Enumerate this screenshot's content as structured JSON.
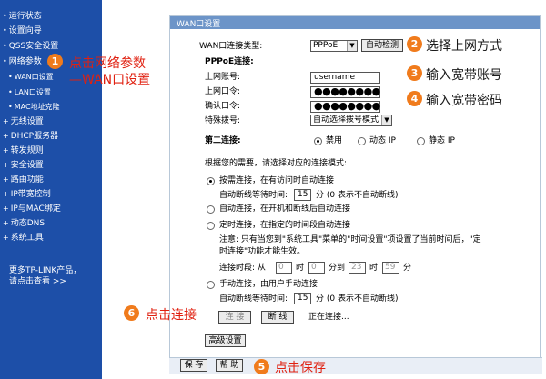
{
  "sidebar": {
    "items": [
      {
        "label": "运行状态"
      },
      {
        "label": "设置向导"
      },
      {
        "label": "QSS安全设置"
      },
      {
        "label": "网络参数"
      },
      {
        "label": "WAN口设置"
      },
      {
        "label": "LAN口设置"
      },
      {
        "label": "MAC地址克隆"
      },
      {
        "label": "无线设置"
      },
      {
        "label": "DHCP服务器"
      },
      {
        "label": "转发规则"
      },
      {
        "label": "安全设置"
      },
      {
        "label": "路由功能"
      },
      {
        "label": "IP带宽控制"
      },
      {
        "label": "IP与MAC绑定"
      },
      {
        "label": "动态DNS"
      },
      {
        "label": "系统工具"
      }
    ],
    "more_line1": "更多TP-LINK产品，",
    "more_line2": "请点击查看 >>"
  },
  "panel": {
    "title": "WAN口设置",
    "wan_type_label": "WAN口连接类型:",
    "wan_type_value": "PPPoE",
    "auto_detect": "自动检测",
    "pppoe_heading": "PPPoE连接:",
    "account_label": "上网账号:",
    "account_value": "username",
    "password_label": "上网口令:",
    "password_value": "●●●●●●●●",
    "confirm_label": "确认口令:",
    "confirm_value": "●●●●●●●●",
    "special_dial_label": "特殊拨号:",
    "special_dial_value": "自动选择拨号模式",
    "second_conn_label": "第二连接:",
    "second_options": [
      "禁用",
      "动态 IP",
      "静态 IP"
    ],
    "mode_intro": "根据您的需要，请选择对应的连接模式:",
    "mode_on_demand": "按需连接，在有访问时自动连接",
    "idle_label": "自动断线等待时间:",
    "idle_value": "15",
    "idle_unit": "分 (0 表示不自动断线)",
    "mode_auto": "自动连接，在开机和断线后自动连接",
    "mode_timed": "定时连接，在指定的时间段自动连接",
    "timed_note1": "注意: 只有当您到\"系统工具\"菜单的\"时间设置\"项设置了当前时间后，\"定",
    "timed_note2": "时连接\"功能才能生效。",
    "period_label": "连接时段: 从",
    "t_from_h": "0",
    "t_hour1": "时",
    "t_from_m": "0",
    "t_to": "分到",
    "t_to_h": "23",
    "t_hour2": "时",
    "t_to_m": "59",
    "t_min": "分",
    "mode_manual": "手动连接，由用户手动连接",
    "idle2_value": "15",
    "connect_btn": "连 接",
    "disconnect_btn": "断 线",
    "status_text": "正在连接...",
    "advanced_btn": "高级设置",
    "save_btn": "保 存",
    "help_btn": "帮 助"
  },
  "annotations": [
    {
      "num": "1",
      "text": "点击网络参数"
    },
    {
      "text": "—WAN口设置"
    },
    {
      "num": "2",
      "text": "选择上网方式"
    },
    {
      "num": "3",
      "text": "输入宽带账号"
    },
    {
      "num": "4",
      "text": "输入宽带密码"
    },
    {
      "num": "5",
      "text": "点击保存"
    },
    {
      "num": "6",
      "text": "点击连接"
    }
  ],
  "colors": {
    "sidebar": "#1d4fa8",
    "title_bar": "#6c94c8",
    "annotation_red": "#e02010",
    "badge_orange": "#f07b1c"
  }
}
